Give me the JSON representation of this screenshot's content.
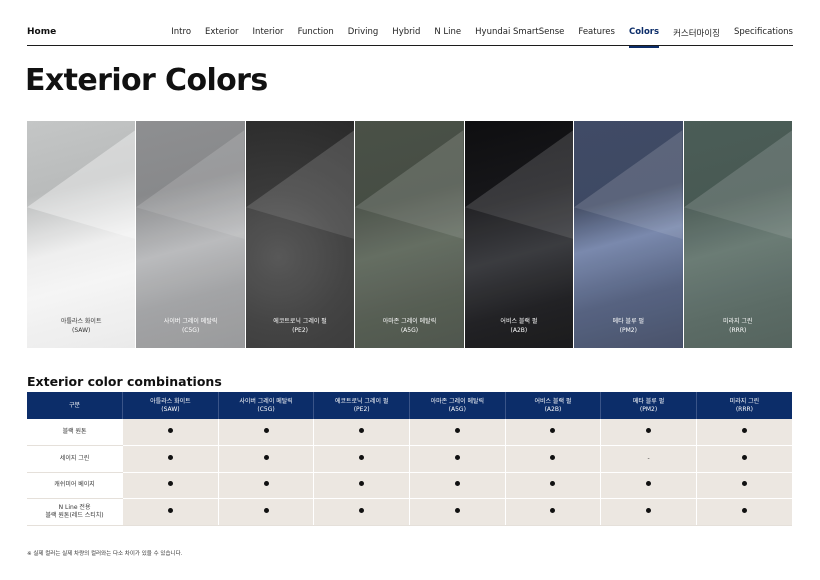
{
  "nav": {
    "home": "Home",
    "items": [
      {
        "label": "Intro",
        "active": false
      },
      {
        "label": "Exterior",
        "active": false
      },
      {
        "label": "Interior",
        "active": false
      },
      {
        "label": "Function",
        "active": false
      },
      {
        "label": "Driving",
        "active": false
      },
      {
        "label": "Hybrid",
        "active": false
      },
      {
        "label": "N Line",
        "active": false
      },
      {
        "label": "Hyundai SmartSense",
        "active": false
      },
      {
        "label": "Features",
        "active": false
      },
      {
        "label": "Colors",
        "active": true
      },
      {
        "label": "커스터마이징",
        "active": false
      },
      {
        "label": "Specifications",
        "active": false
      }
    ],
    "active_color": "#0c2d69"
  },
  "page_title": "Exterior Colors",
  "swatches": [
    {
      "name": "아틀라스 화이트",
      "code": "(SAW)"
    },
    {
      "name": "사이버 그레이 메탈릭",
      "code": "(C5G)"
    },
    {
      "name": "에코트로닉 그레이 펄",
      "code": "(PE2)"
    },
    {
      "name": "아마존 그레이 메탈릭",
      "code": "(A5G)"
    },
    {
      "name": "어비스 블랙 펄",
      "code": "(A2B)"
    },
    {
      "name": "메타 블루 펄",
      "code": "(PM2)"
    },
    {
      "name": "미라지 그린",
      "code": "(RRR)"
    }
  ],
  "combinations": {
    "title": "Exterior color combinations",
    "header_first": "구분",
    "header_color": "#0c2d69",
    "columns": [
      {
        "name": "아틀라스 화이트",
        "code": "(SAW)"
      },
      {
        "name": "사이버 그레이 메탈릭",
        "code": "(C5G)"
      },
      {
        "name": "에코트로닉 그레이 펄",
        "code": "(PE2)"
      },
      {
        "name": "아마존 그레이 메탈릭",
        "code": "(A5G)"
      },
      {
        "name": "어비스 블랙 펄",
        "code": "(A2B)"
      },
      {
        "name": "메타 블루 펄",
        "code": "(PM2)"
      },
      {
        "name": "미라지 그린",
        "code": "(RRR)"
      }
    ],
    "rows": [
      {
        "label": [
          "블랙 원톤"
        ],
        "cells": [
          "●",
          "●",
          "●",
          "●",
          "●",
          "●",
          "●"
        ]
      },
      {
        "label": [
          "세이지 그린"
        ],
        "cells": [
          "●",
          "●",
          "●",
          "●",
          "●",
          "-",
          "●"
        ]
      },
      {
        "label": [
          "캐쉬미어 베이지"
        ],
        "cells": [
          "●",
          "●",
          "●",
          "●",
          "●",
          "●",
          "●"
        ]
      },
      {
        "label": [
          "N Line 전용",
          "블랙 원톤(레드 스티치)"
        ],
        "cells": [
          "●",
          "●",
          "●",
          "●",
          "●",
          "●",
          "●"
        ]
      }
    ]
  },
  "footnote": "※ 실제 컬러는 실제 차량의 컬러와는 다소 차이가 있을 수 있습니다."
}
